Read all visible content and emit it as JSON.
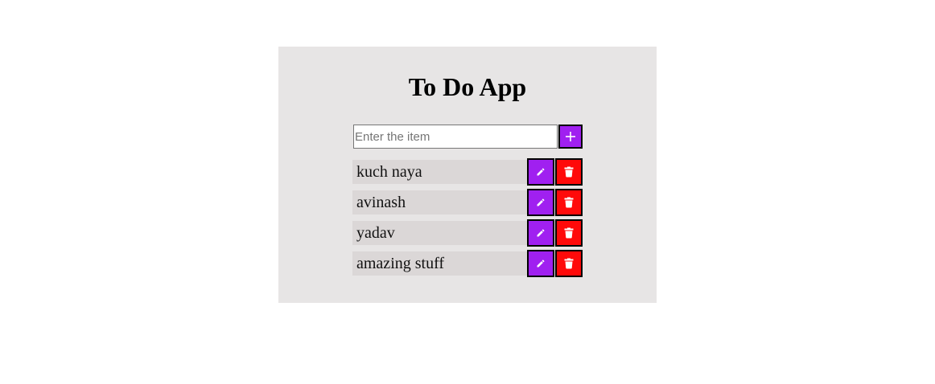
{
  "app": {
    "title": "To Do App"
  },
  "input": {
    "placeholder": "Enter the item",
    "value": ""
  },
  "add_button": {
    "icon": "plus-icon",
    "color": "#a020f0"
  },
  "items": [
    {
      "text": "kuch naya"
    },
    {
      "text": "avinash"
    },
    {
      "text": "yadav"
    },
    {
      "text": "amazing stuff"
    }
  ],
  "item_actions": {
    "edit_icon": "pencil-icon",
    "edit_color": "#a020f0",
    "delete_icon": "trash-icon",
    "delete_color": "#ff0a0a"
  },
  "colors": {
    "card_background": "#e7e5e5",
    "item_background": "#dbd7d7"
  }
}
